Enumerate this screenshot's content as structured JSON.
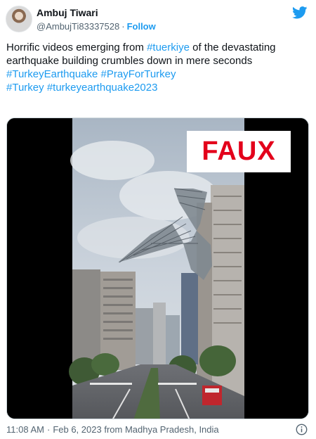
{
  "user": {
    "display_name": "Ambuj Tiwari",
    "handle": "@AmbujTi83337528",
    "separator": "·",
    "follow_label": "Follow"
  },
  "tweet": {
    "text_part1": "Horrific videos emerging from ",
    "hashtag_tuerkiye": "#tuerkiye",
    "text_part2": " of the devastating earthquake building crumbles down in mere seconds",
    "hashtag_turkey_earthquake": "#TurkeyEarthquake",
    "hashtag_pray_for_turkey": "#PrayForTurkey",
    "hashtag_turkey": "#Turkey",
    "hashtag_turkeyearthquake2023": "#turkeyearthquake2023"
  },
  "media": {
    "stamp_text": "FAUX",
    "stamp_color": "#e3001b"
  },
  "footer": {
    "time": "11:08 AM",
    "separator": "·",
    "date": "Feb 6, 2023",
    "source": "from Madhya Pradesh, India"
  },
  "icons": {
    "brand": "twitter-bird-icon",
    "info": "info-icon"
  },
  "colors": {
    "accent": "#1d9bf0",
    "text": "#0f1419",
    "muted": "#536471"
  }
}
